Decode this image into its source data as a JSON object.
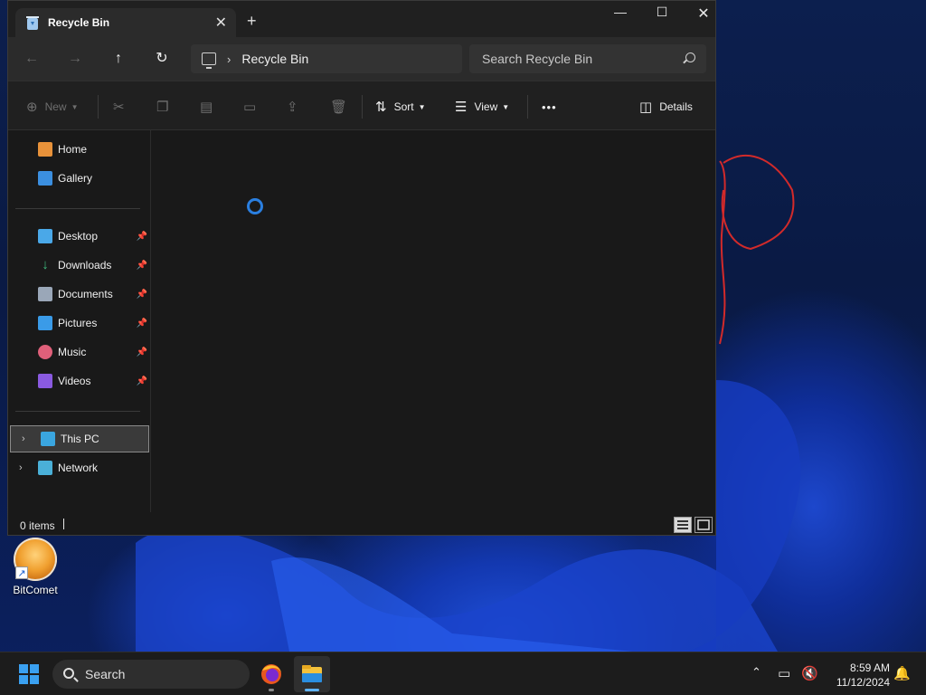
{
  "window": {
    "tab_title": "Recycle Bin",
    "tab_close": "✕",
    "new_tab": "+",
    "minimize": "—",
    "maximize": "☐",
    "close": "✕"
  },
  "navbar": {
    "back": "←",
    "forward": "→",
    "up": "↑",
    "refresh": "↻",
    "address_chevron": "›",
    "address_path": "Recycle Bin",
    "search_placeholder": "Search Recycle Bin"
  },
  "commandbar": {
    "new_label": "New",
    "sort_label": "Sort",
    "view_label": "View",
    "more_label": "•••",
    "details_label": "Details"
  },
  "sidebar": {
    "quick": [
      {
        "label": "Home",
        "icon": "home-icon"
      },
      {
        "label": "Gallery",
        "icon": "gallery-icon"
      }
    ],
    "pinned": [
      {
        "label": "Desktop",
        "icon": "desktop-folder-icon"
      },
      {
        "label": "Downloads",
        "icon": "downloads-folder-icon"
      },
      {
        "label": "Documents",
        "icon": "documents-folder-icon"
      },
      {
        "label": "Pictures",
        "icon": "pictures-folder-icon"
      },
      {
        "label": "Music",
        "icon": "music-folder-icon"
      },
      {
        "label": "Videos",
        "icon": "videos-folder-icon"
      }
    ],
    "locations": [
      {
        "label": "This PC",
        "icon": "this-pc-icon",
        "selected": true
      },
      {
        "label": "Network",
        "icon": "network-icon",
        "selected": false
      }
    ]
  },
  "statusbar": {
    "item_count": "0 items"
  },
  "desktop": {
    "icons": [
      {
        "label": "BitComet",
        "icon": "bitcomet-icon"
      }
    ]
  },
  "taskbar": {
    "search_label": "Search",
    "time": "8:59 AM",
    "date": "11/12/2024"
  },
  "colors": {
    "accent": "#2a7fe0",
    "window_bg": "#191919",
    "toolbar_bg": "#2b2b2b",
    "taskbar_bg": "#1c1c1c"
  }
}
